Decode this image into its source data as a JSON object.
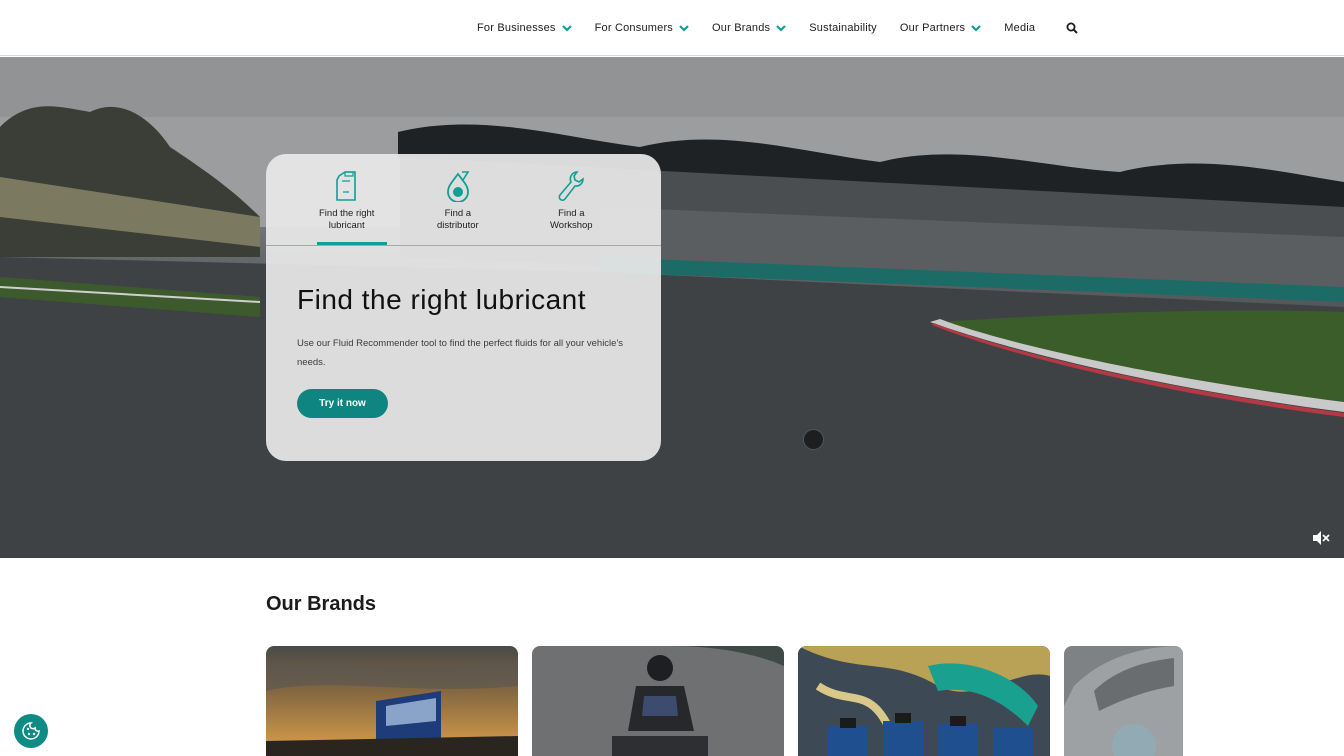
{
  "nav": {
    "items": [
      {
        "label": "For Businesses",
        "has_dropdown": true
      },
      {
        "label": "For Consumers",
        "has_dropdown": true
      },
      {
        "label": "Our Brands",
        "has_dropdown": true
      },
      {
        "label": "Sustainability",
        "has_dropdown": false
      },
      {
        "label": "Our Partners",
        "has_dropdown": true
      },
      {
        "label": "Media",
        "has_dropdown": false
      }
    ],
    "search_icon": "search-icon",
    "accent_color": "#119f95"
  },
  "hero": {
    "tabs": [
      {
        "label_line1": "Find the right",
        "label_line2": "lubricant",
        "icon": "oil-can-icon",
        "active": true
      },
      {
        "label_line1": "Find a",
        "label_line2": "distributor",
        "icon": "oil-drop-icon",
        "active": false
      },
      {
        "label_line1": "Find a",
        "label_line2": "Workshop",
        "icon": "wrench-icon",
        "active": false
      }
    ],
    "title": "Find the right lubricant",
    "description": "Use our Fluid Recommender tool to find the perfect fluids for all your vehicle's needs.",
    "button_label": "Try it now",
    "button_color": "#0f8582",
    "mute_icon": "mute-icon"
  },
  "brands": {
    "title": "Our Brands",
    "cards": [
      {
        "name": "truck-at-sunset"
      },
      {
        "name": "motorcycle-rider"
      },
      {
        "name": "oil-bottles-splash"
      },
      {
        "name": "car-partial"
      }
    ]
  },
  "cookie": {
    "icon": "cookie-icon",
    "color": "#0e8b84"
  }
}
